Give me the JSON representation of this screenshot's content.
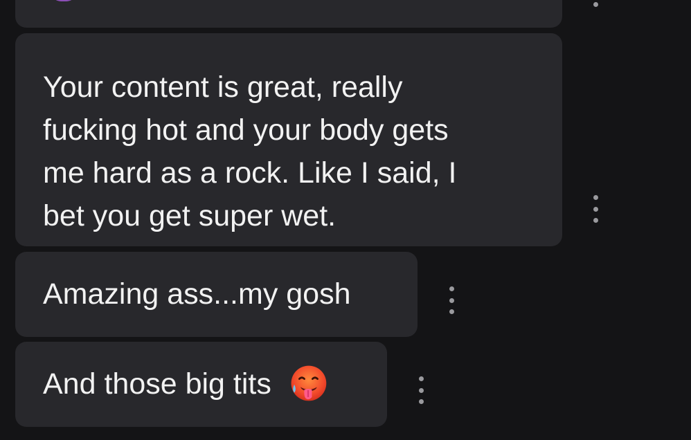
{
  "messages": [
    {
      "text": "Your content is great, really\nfucking hot and your body gets\nme hard as a rock. Like I said, I\nbet you get super wet.",
      "options_icon": "more-vertical-icon"
    },
    {
      "text": "Amazing ass...my gosh",
      "options_icon": "more-vertical-icon"
    },
    {
      "text": "And those big tits",
      "emoji": "hot-face-emoji-icon",
      "options_icon": "more-vertical-icon"
    }
  ],
  "colors": {
    "background": "#141416",
    "bubble": "#28282c",
    "text": "#f2f2f2",
    "options_dots": "#9a9a9e",
    "avatar_partial": "#8d4fb8"
  }
}
